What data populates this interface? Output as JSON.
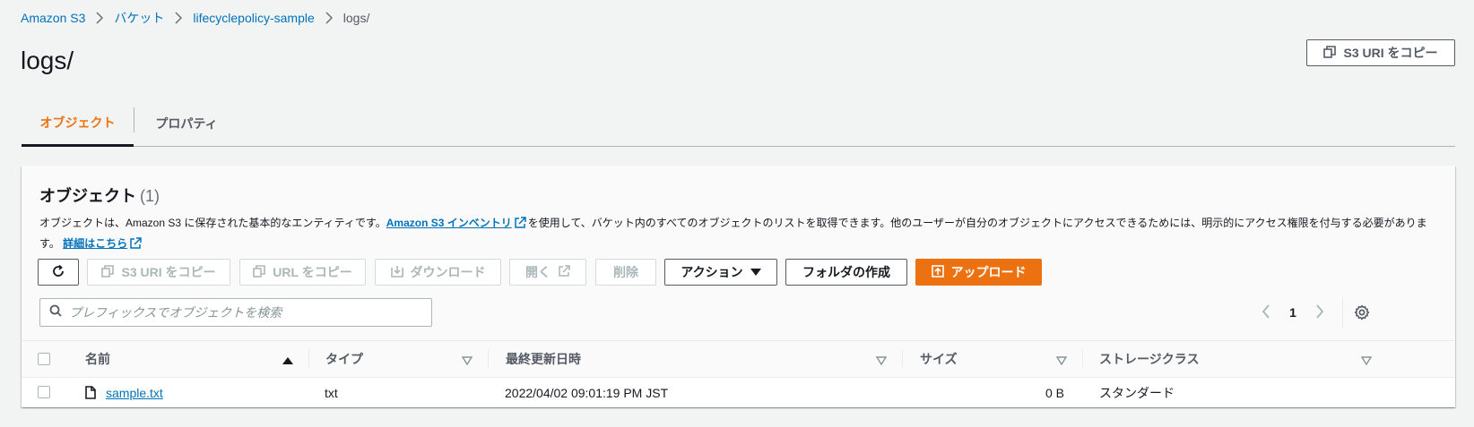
{
  "breadcrumb": {
    "items": [
      "Amazon S3",
      "バケット",
      "lifecyclepolicy-sample"
    ],
    "current": "logs/"
  },
  "page": {
    "title": "logs/",
    "copy_uri_label": "S3 URI をコピー"
  },
  "tabs": [
    {
      "label": "オブジェクト",
      "active": true
    },
    {
      "label": "プロパティ",
      "active": false
    }
  ],
  "panel": {
    "title": "オブジェクト",
    "count": "(1)",
    "description_prefix": "オブジェクトは、Amazon S3 に保存された基本的なエンティティです。",
    "inventory_link": "Amazon S3 インベントリ",
    "description_suffix": "を使用して、バケット内のすべてのオブジェクトのリストを取得できます。他のユーザーが自分のオブジェクトにアクセスできるためには、明示的にアクセス権限を付与する必要があります。",
    "learn_more": "詳細はこちら"
  },
  "toolbar": {
    "copy_s3_uri": "S3 URI をコピー",
    "copy_url": "URL をコピー",
    "download": "ダウンロード",
    "open": "開く",
    "delete": "削除",
    "actions": "アクション",
    "create_folder": "フォルダの作成",
    "upload": "アップロード"
  },
  "search": {
    "placeholder": "プレフィックスでオブジェクトを検索"
  },
  "pagination": {
    "current_page": "1"
  },
  "table": {
    "columns": [
      "名前",
      "タイプ",
      "最終更新日時",
      "サイズ",
      "ストレージクラス"
    ],
    "rows": [
      {
        "name": "sample.txt",
        "type": "txt",
        "modified": "2022/04/02 09:01:19 PM JST",
        "size": "0 B",
        "storage_class": "スタンダード"
      }
    ]
  },
  "colors": {
    "accent": "#ec7211",
    "link": "#0073bb"
  }
}
